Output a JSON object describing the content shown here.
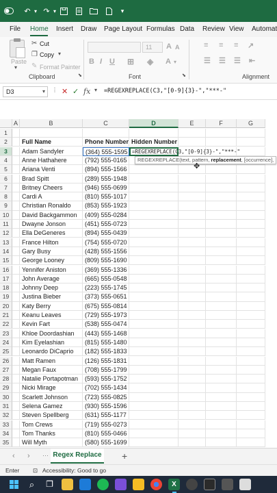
{
  "formula_bar": {
    "cell_ref": "D3",
    "formula": "=REGEXREPLACE(C3,\"[0-9]{3}-\",\"***-\""
  },
  "menu": [
    "File",
    "Home",
    "Insert",
    "Draw",
    "Page Layout",
    "Formulas",
    "Data",
    "Review",
    "View",
    "Automate"
  ],
  "ribbon": {
    "paste": "Paste",
    "cut": "Cut",
    "copy": "Copy",
    "format_painter": "Format Painter",
    "clipboard": "Clipboard",
    "font": "Font",
    "alignment": "Alignment",
    "font_size": "11"
  },
  "columns": [
    "A",
    "B",
    "C",
    "D",
    "E",
    "F",
    "G"
  ],
  "headers": {
    "name": "Full Name",
    "phone": "Phone Number",
    "hidden": "Hidden Number"
  },
  "active_cell": {
    "formula": "=REGEXREPLACE(C3,\"[0-9]{3}-\",\"***-\""
  },
  "tooltip": {
    "fn": "REGEXREPLACE(text, pattern, ",
    "bold": "replacement",
    "rest": ", [occurrence], "
  },
  "rows": [
    {
      "n": "1",
      "name": "",
      "phone": ""
    },
    {
      "n": "2",
      "name": "Full Name",
      "phone": "Phone Number"
    },
    {
      "n": "3",
      "name": "Adam Sandyler",
      "phone": "(364) 555-1595"
    },
    {
      "n": "4",
      "name": "Anne Hathahere",
      "phone": "(792) 555-0165"
    },
    {
      "n": "5",
      "name": "Ariana Venti",
      "phone": "(894) 555-1566"
    },
    {
      "n": "6",
      "name": "Brad Spitt",
      "phone": "(289) 555-1948"
    },
    {
      "n": "7",
      "name": "Britney Cheers",
      "phone": "(946) 555-0699"
    },
    {
      "n": "8",
      "name": "Cardi A",
      "phone": "(810) 555-1017"
    },
    {
      "n": "9",
      "name": "Christian Ronaldo",
      "phone": "(853) 555-1923"
    },
    {
      "n": "10",
      "name": "David Backgammon",
      "phone": "(409) 555-0284"
    },
    {
      "n": "11",
      "name": "Dwayne Jonson",
      "phone": "(451) 555-0723"
    },
    {
      "n": "12",
      "name": "Ella DeGeneres",
      "phone": "(894) 555-0439"
    },
    {
      "n": "13",
      "name": "France Hilton",
      "phone": "(754) 555-0720"
    },
    {
      "n": "14",
      "name": "Gary Busy",
      "phone": "(428) 555-1556"
    },
    {
      "n": "15",
      "name": "George Looney",
      "phone": "(809) 555-1690"
    },
    {
      "n": "16",
      "name": "Yennifer Aniston",
      "phone": "(369) 555-1336"
    },
    {
      "n": "17",
      "name": "John Average",
      "phone": "(665) 555-0548"
    },
    {
      "n": "18",
      "name": "Johnny Deep",
      "phone": "(223) 555-1745"
    },
    {
      "n": "19",
      "name": "Justina Bieber",
      "phone": "(373) 555-0651"
    },
    {
      "n": "20",
      "name": "Katy Berry",
      "phone": "(675) 555-0814"
    },
    {
      "n": "21",
      "name": "Keanu Leaves",
      "phone": "(729) 555-1973"
    },
    {
      "n": "22",
      "name": "Kevin Fart",
      "phone": "(538) 555-0474"
    },
    {
      "n": "23",
      "name": "Khloe Doordashian",
      "phone": "(443) 555-1468"
    },
    {
      "n": "24",
      "name": "Kim Eyelashian",
      "phone": "(815) 555-1480"
    },
    {
      "n": "25",
      "name": "Leonardo DiCaprio",
      "phone": "(182) 555-1833"
    },
    {
      "n": "26",
      "name": "Matt Ramen",
      "phone": "(126) 555-1831"
    },
    {
      "n": "27",
      "name": "Megan Faux",
      "phone": "(708) 555-1799"
    },
    {
      "n": "28",
      "name": "Natalie Portapotman",
      "phone": "(593) 555-1752"
    },
    {
      "n": "29",
      "name": "Nicki Mirage",
      "phone": "(702) 555-1434"
    },
    {
      "n": "30",
      "name": "Scarlett Johnson",
      "phone": "(723) 555-0825"
    },
    {
      "n": "31",
      "name": "Selena Gamez",
      "phone": "(930) 555-1596"
    },
    {
      "n": "32",
      "name": "Steven Spellberg",
      "phone": "(631) 555-1177"
    },
    {
      "n": "33",
      "name": "Tom Crews",
      "phone": "(719) 555-0273"
    },
    {
      "n": "34",
      "name": "Tom Thanks",
      "phone": "(810) 555-0466"
    },
    {
      "n": "35",
      "name": "Will Myth",
      "phone": "(580) 555-1699"
    }
  ],
  "sheet_tab": "Regex Replace",
  "status": {
    "mode": "Enter",
    "accessibility": "Accessibility: Good to go"
  }
}
